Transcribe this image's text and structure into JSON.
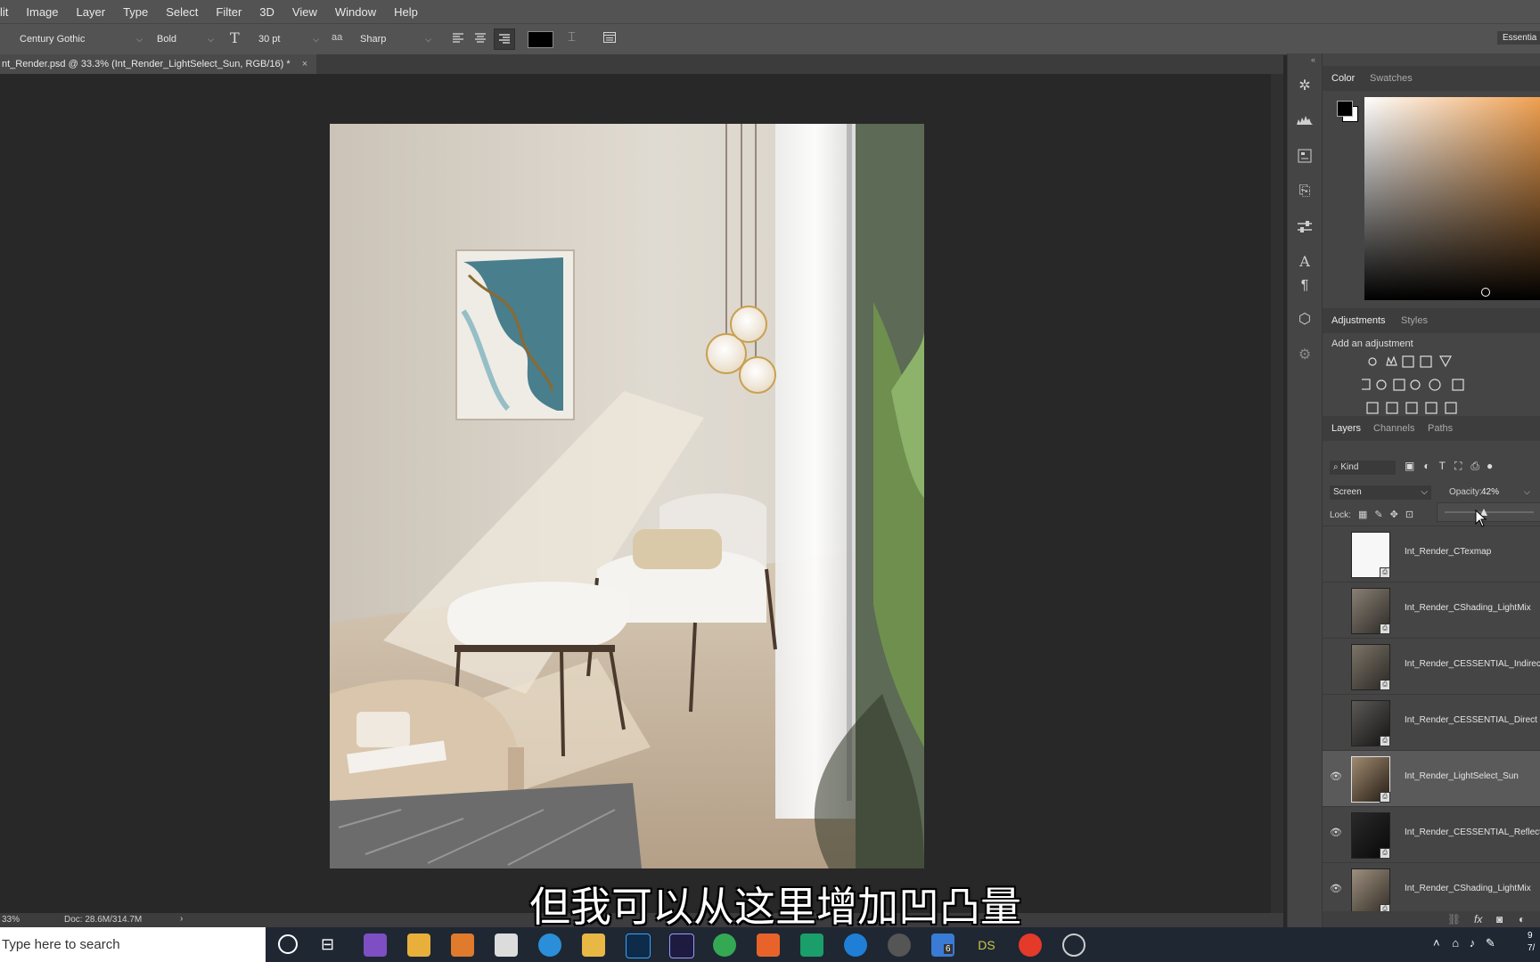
{
  "menu": [
    "lit",
    "Image",
    "Layer",
    "Type",
    "Select",
    "Filter",
    "3D",
    "View",
    "Window",
    "Help"
  ],
  "options": {
    "font_family": "Century Gothic",
    "font_style": "Bold",
    "font_size": "30 pt",
    "aa_icon": "aa",
    "anti_alias": "Sharp",
    "workspace": "Essentia"
  },
  "document": {
    "tab_title": "nt_Render.psd @ 33.3% (Int_Render_LightSelect_Sun, RGB/16) *",
    "close": "×"
  },
  "status": {
    "zoom": "33%",
    "doc": "Doc: 28.6M/314.7M",
    "arrow": "›"
  },
  "panels": {
    "color_tab": "Color",
    "swatches_tab": "Swatches",
    "adjustments_tab": "Adjustments",
    "styles_tab": "Styles",
    "add_adjustment": "Add an adjustment",
    "layers_tab": "Layers",
    "channels_tab": "Channels",
    "paths_tab": "Paths",
    "kind": "Kind",
    "blend_mode": "Screen",
    "opacity_label": "Opacity:",
    "opacity_value": "42%",
    "lock_label": "Lock:",
    "fx": "fx"
  },
  "layers": [
    {
      "name": "Int_Render_CTexmap",
      "visible": false,
      "thumb": "white"
    },
    {
      "name": "Int_Render_CShading_LightMix",
      "visible": false,
      "thumb": "room"
    },
    {
      "name": "Int_Render_CESSENTIAL_Indirect",
      "visible": false,
      "thumb": "room"
    },
    {
      "name": "Int_Render_CESSENTIAL_Direct",
      "visible": false,
      "thumb": "dark"
    },
    {
      "name": "Int_Render_LightSelect_Sun",
      "visible": true,
      "thumb": "room",
      "selected": true
    },
    {
      "name": "Int_Render_CESSENTIAL_Reflect",
      "visible": true,
      "thumb": "black"
    },
    {
      "name": "Int_Render_CShading_LightMix",
      "visible": true,
      "thumb": "room"
    }
  ],
  "taskbar": {
    "search_placeholder": "Type here to search",
    "badge": "6",
    "ds_label": "DS",
    "clock_top": "9",
    "clock_bottom": "7/"
  },
  "subtitle": "但我可以从这里增加凹凸量",
  "colors": {
    "foreground": "#000000",
    "background": "#ffffff",
    "picker_hue": "#f0a050"
  }
}
